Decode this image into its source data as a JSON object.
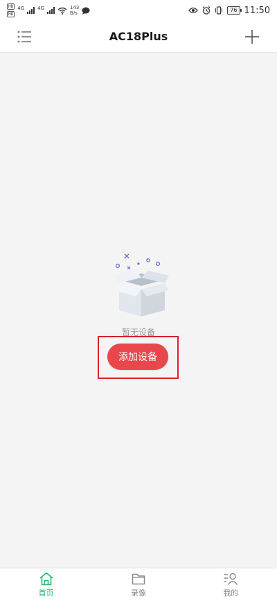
{
  "status_bar": {
    "sim1": "HD",
    "sim2": "HD",
    "net1": "4G",
    "net2": "4G",
    "speed_value": "143",
    "speed_unit": "B/s",
    "battery": "76",
    "time": "11:50"
  },
  "header": {
    "title": "AC18Plus"
  },
  "empty_state": {
    "message": "暂无设备",
    "add_button_label": "添加设备"
  },
  "bottom_nav": {
    "items": [
      {
        "label": "首页",
        "active": true
      },
      {
        "label": "录像",
        "active": false
      },
      {
        "label": "我的",
        "active": false
      }
    ]
  },
  "colors": {
    "accent": "#e8474c",
    "nav_active": "#2bb673",
    "highlight": "#d8202c"
  }
}
